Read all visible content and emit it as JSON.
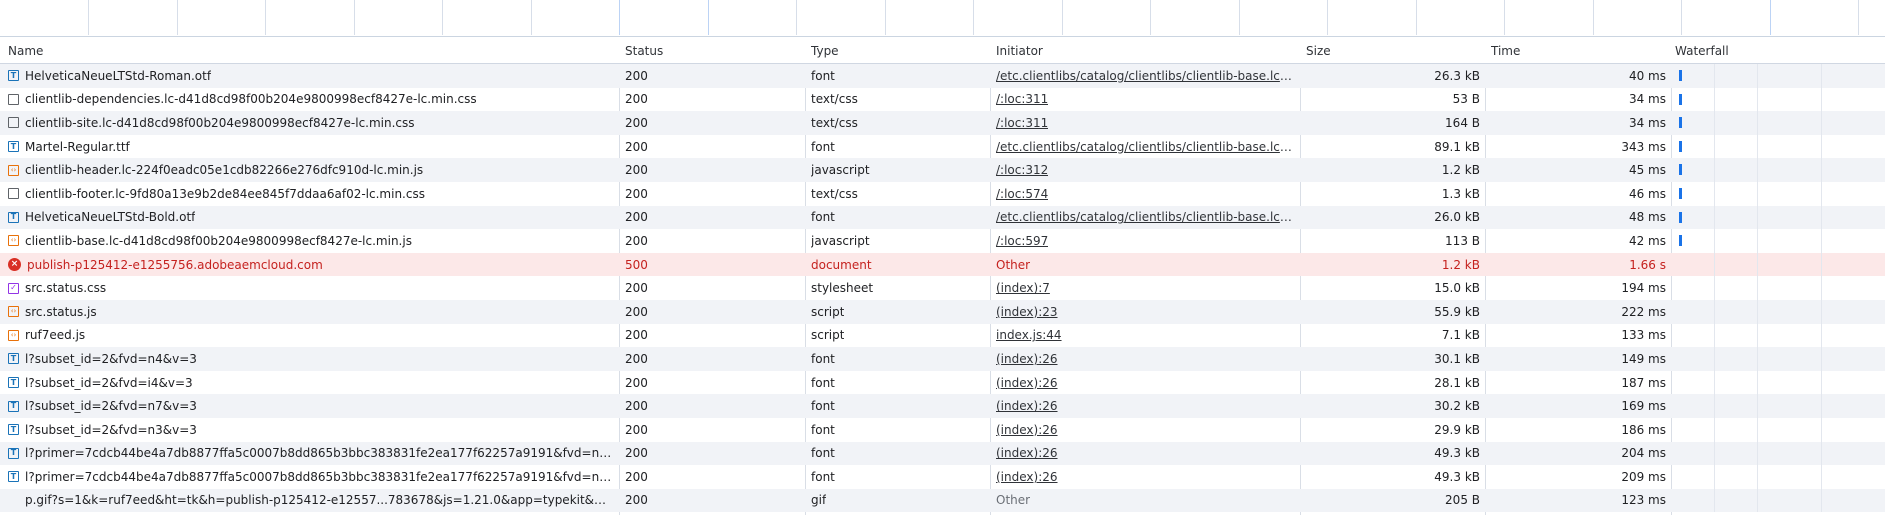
{
  "columns": {
    "name": "Name",
    "status": "Status",
    "type": "Type",
    "initiator": "Initiator",
    "size": "Size",
    "time": "Time",
    "waterfall": "Waterfall"
  },
  "colors": {
    "error_row_bg": "#fce8e8",
    "error_text": "#c5221f",
    "waterfall_bar": "#1a73e8",
    "font_icon": "#1a73b8",
    "script_icon": "#e8710a",
    "css_icon": "#9334e6"
  },
  "rows": [
    {
      "name": "HelveticaNeueLTStd-Roman.otf",
      "icon": "font-icon",
      "status": "200",
      "type": "font",
      "initiator": "/etc.clientlibs/catalog/clientlibs/clientlib-base.lc-...",
      "initiator_link": true,
      "size": "26.3 kB",
      "time": "40 ms",
      "waterfall_bar": true
    },
    {
      "name": "clientlib-dependencies.lc-d41d8cd98f00b204e9800998ecf8427e-lc.min.css",
      "icon": "document-icon",
      "status": "200",
      "type": "text/css",
      "initiator": "/:loc:311",
      "initiator_link": true,
      "size": "53 B",
      "time": "34 ms",
      "waterfall_bar": true
    },
    {
      "name": "clientlib-site.lc-d41d8cd98f00b204e9800998ecf8427e-lc.min.css",
      "icon": "document-icon",
      "status": "200",
      "type": "text/css",
      "initiator": "/:loc:311",
      "initiator_link": true,
      "size": "164 B",
      "time": "34 ms",
      "waterfall_bar": true
    },
    {
      "name": "Martel-Regular.ttf",
      "icon": "font-icon",
      "status": "200",
      "type": "font",
      "initiator": "/etc.clientlibs/catalog/clientlibs/clientlib-base.lc-...",
      "initiator_link": true,
      "size": "89.1 kB",
      "time": "343 ms",
      "waterfall_bar": true
    },
    {
      "name": "clientlib-header.lc-224f0eadc05e1cdb82266e276dfc910d-lc.min.js",
      "icon": "script-icon",
      "status": "200",
      "type": "javascript",
      "initiator": "/:loc:312",
      "initiator_link": true,
      "size": "1.2 kB",
      "time": "45 ms",
      "waterfall_bar": true
    },
    {
      "name": "clientlib-footer.lc-9fd80a13e9b2de84ee845f7ddaa6af02-lc.min.css",
      "icon": "document-icon",
      "status": "200",
      "type": "text/css",
      "initiator": "/:loc:574",
      "initiator_link": true,
      "size": "1.3 kB",
      "time": "46 ms",
      "waterfall_bar": true
    },
    {
      "name": "HelveticaNeueLTStd-Bold.otf",
      "icon": "font-icon",
      "status": "200",
      "type": "font",
      "initiator": "/etc.clientlibs/catalog/clientlibs/clientlib-base.lc-...",
      "initiator_link": true,
      "size": "26.0 kB",
      "time": "48 ms",
      "waterfall_bar": true
    },
    {
      "name": "clientlib-base.lc-d41d8cd98f00b204e9800998ecf8427e-lc.min.js",
      "icon": "script-icon",
      "status": "200",
      "type": "javascript",
      "initiator": "/:loc:597",
      "initiator_link": true,
      "size": "113 B",
      "time": "42 ms",
      "waterfall_bar": true
    },
    {
      "name": "publish-p125412-e1255756.adobeaemcloud.com",
      "icon": "error-icon",
      "status": "500",
      "type": "document",
      "initiator": "Other",
      "initiator_link": false,
      "size": "1.2 kB",
      "time": "1.66 s",
      "waterfall_bar": false,
      "error": true
    },
    {
      "name": "src.status.css",
      "icon": "css-icon",
      "status": "200",
      "type": "stylesheet",
      "initiator": "(index):7",
      "initiator_link": true,
      "size": "15.0 kB",
      "time": "194 ms",
      "waterfall_bar": false
    },
    {
      "name": "src.status.js",
      "icon": "script-icon",
      "status": "200",
      "type": "script",
      "initiator": "(index):23",
      "initiator_link": true,
      "size": "55.9 kB",
      "time": "222 ms",
      "waterfall_bar": false
    },
    {
      "name": "ruf7eed.js",
      "icon": "script-icon",
      "status": "200",
      "type": "script",
      "initiator": "index.js:44",
      "initiator_link": true,
      "size": "7.1 kB",
      "time": "133 ms",
      "waterfall_bar": false
    },
    {
      "name": "l?subset_id=2&fvd=n4&v=3",
      "icon": "font-icon",
      "status": "200",
      "type": "font",
      "initiator": "(index):26",
      "initiator_link": true,
      "size": "30.1 kB",
      "time": "149 ms",
      "waterfall_bar": false
    },
    {
      "name": "l?subset_id=2&fvd=i4&v=3",
      "icon": "font-icon",
      "status": "200",
      "type": "font",
      "initiator": "(index):26",
      "initiator_link": true,
      "size": "28.1 kB",
      "time": "187 ms",
      "waterfall_bar": false
    },
    {
      "name": "l?subset_id=2&fvd=n7&v=3",
      "icon": "font-icon",
      "status": "200",
      "type": "font",
      "initiator": "(index):26",
      "initiator_link": true,
      "size": "30.2 kB",
      "time": "169 ms",
      "waterfall_bar": false
    },
    {
      "name": "l?subset_id=2&fvd=n3&v=3",
      "icon": "font-icon",
      "status": "200",
      "type": "font",
      "initiator": "(index):26",
      "initiator_link": true,
      "size": "29.9 kB",
      "time": "186 ms",
      "waterfall_bar": false
    },
    {
      "name": "l?primer=7cdcb44be4a7db8877ffa5c0007b8dd865b3bbc383831fe2ea177f62257a9191&fvd=n7&...",
      "icon": "font-icon",
      "status": "200",
      "type": "font",
      "initiator": "(index):26",
      "initiator_link": true,
      "size": "49.3 kB",
      "time": "204 ms",
      "waterfall_bar": false
    },
    {
      "name": "l?primer=7cdcb44be4a7db8877ffa5c0007b8dd865b3bbc383831fe2ea177f62257a9191&fvd=n4&...",
      "icon": "font-icon",
      "status": "200",
      "type": "font",
      "initiator": "(index):26",
      "initiator_link": true,
      "size": "49.3 kB",
      "time": "209 ms",
      "waterfall_bar": false
    },
    {
      "name": "p.gif?s=1&k=ruf7eed&ht=tk&h=publish-p125412-e12557...783678&js=1.21.0&app=typekit&e=...",
      "icon": "none",
      "status": "200",
      "type": "gif",
      "initiator": "Other",
      "initiator_link": false,
      "size": "205 B",
      "time": "123 ms",
      "waterfall_bar": false
    }
  ]
}
